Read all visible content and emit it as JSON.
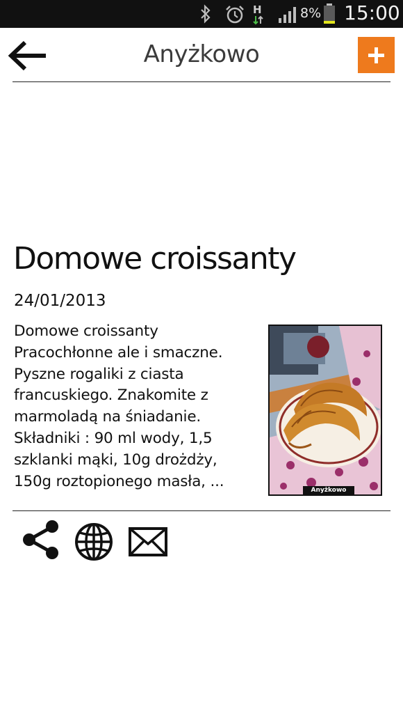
{
  "status_bar": {
    "battery_percent": "8%",
    "time": "15:00",
    "network_type": "H",
    "icons": [
      "bluetooth-icon",
      "alarm-icon",
      "hspa-data-icon",
      "signal-strength-icon",
      "battery-icon"
    ]
  },
  "header": {
    "title": "Anyżkowo",
    "back_icon": "arrow-left-icon",
    "add_icon": "plus-icon",
    "accent_color": "#ee7a1d"
  },
  "article": {
    "title": "Domowe croissanty",
    "date": "24/01/2013",
    "excerpt_lines": [
      "Domowe croissanty",
      "Pracochłonne ale i smaczne.",
      "Pyszne rogaliki z ciasta",
      "francuskiego. Znakomite z",
      "marmoladą na śniadanie.",
      "Składniki : 90 ml wody, 1,5",
      "szklanki mąki, 10g drożdży,",
      "150g roztopionego masła, ..."
    ],
    "thumbnail_caption": "Anyżkowo"
  },
  "actions": {
    "icons": [
      "share-icon",
      "globe-icon",
      "mail-icon"
    ]
  }
}
